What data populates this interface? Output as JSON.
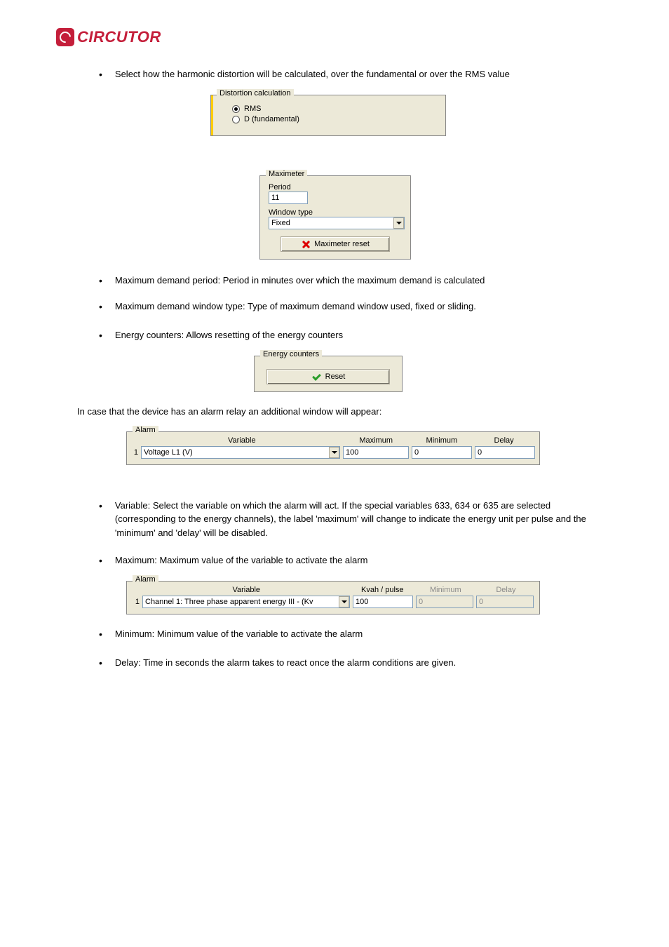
{
  "logo": {
    "text": "CIRCUTOR"
  },
  "sections": {
    "distortion": {
      "title": "Distortion calculation",
      "intro": "Select how the harmonic distortion will be calculated, over the fundamental or over the RMS value",
      "opts": {
        "rms": "RMS",
        "d": "D (fundamental)"
      }
    },
    "maximeter": {
      "title": "Maximeter",
      "period_lbl": "Period",
      "period_val": "11",
      "window_lbl": "Window type",
      "window_val": "Fixed",
      "reset_btn": "Maximeter reset"
    },
    "bullets_mid": {
      "b1": "Maximum demand period: Period in minutes over which the maximum demand is calculated",
      "b2": "Maximum demand window type: Type of maximum demand window used, fixed or sliding.",
      "b3": "Energy counters: Allows resetting of the energy counters"
    },
    "energy": {
      "title": "Energy counters",
      "reset_btn": "Reset"
    },
    "alarm_para": "In case that the device has an alarm relay an additional window will appear:",
    "alarm1": {
      "legend": "Alarm",
      "cols": {
        "var": "Variable",
        "max": "Maximum",
        "min": "Minimum",
        "del": "Delay"
      },
      "row": {
        "idx": "1",
        "var": "Voltage L1 (V)",
        "max": "100",
        "min": "0",
        "del": "0"
      }
    },
    "bullets_bot": {
      "b1": "Variable: Select the variable on which the alarm will act. If the special variables 633, 634 or 635 are selected (corresponding to the energy channels), the label 'maximum' will change to indicate the energy unit per pulse and the 'minimum' and 'delay' will be disabled.",
      "b2": "Maximum: Maximum value of the variable to activate the alarm"
    },
    "alarm2": {
      "legend": "Alarm",
      "cols": {
        "var": "Variable",
        "max": "Kvah / pulse",
        "min": "Minimum",
        "del": "Delay"
      },
      "row": {
        "idx": "1",
        "var": "Channel 1: Three phase apparent energy III - (Kv",
        "max": "100",
        "min": "0",
        "del": "0"
      }
    },
    "bullets_last": {
      "b1": "Minimum: Minimum value of the variable to activate the alarm",
      "b2": "Delay: Time in seconds the alarm takes to react once the alarm conditions are given."
    }
  }
}
